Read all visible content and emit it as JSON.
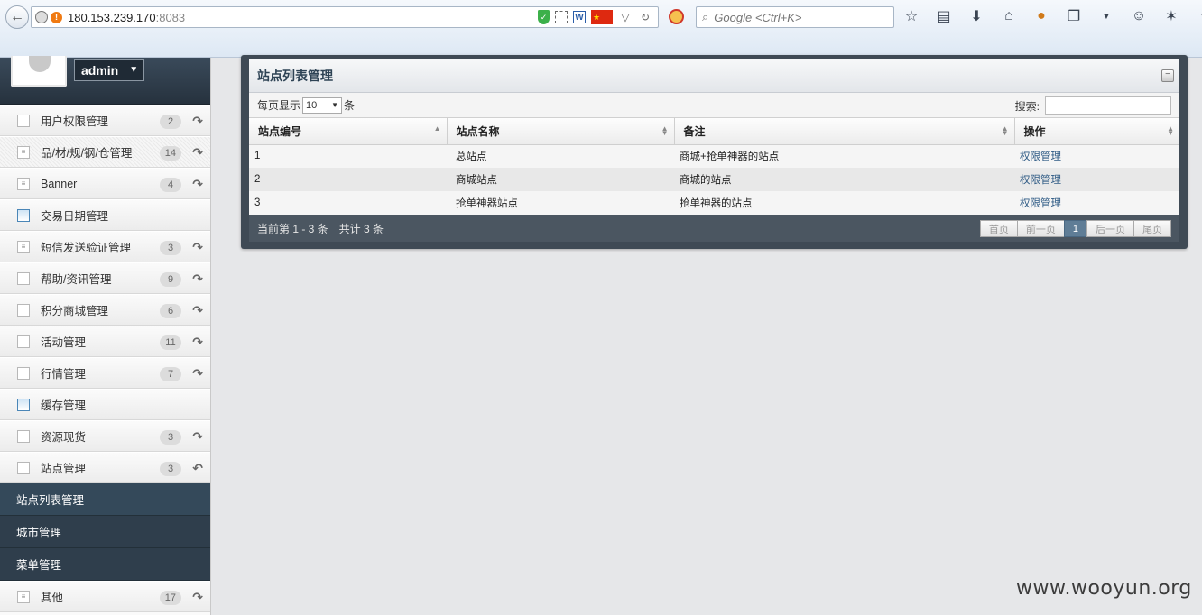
{
  "browser": {
    "url_host": "180.153.239.170",
    "url_port": ":8083",
    "search_placeholder": "Google <Ctrl+K>"
  },
  "user": {
    "name": "admin"
  },
  "sidebar": {
    "items": [
      {
        "label": "用户权限管理",
        "count": "2",
        "icon": "doc-icon"
      },
      {
        "label": "品/材/规/钢/仓管理",
        "count": "14",
        "icon": "list-icon"
      },
      {
        "label": "Banner",
        "count": "4",
        "icon": "list-icon"
      },
      {
        "label": "交易日期管理",
        "count": "",
        "icon": "window-icon"
      },
      {
        "label": "短信发送验证管理",
        "count": "3",
        "icon": "list-icon"
      },
      {
        "label": "帮助/资讯管理",
        "count": "9",
        "icon": "doc-icon"
      },
      {
        "label": "积分商城管理",
        "count": "6",
        "icon": "doc-icon"
      },
      {
        "label": "活动管理",
        "count": "11",
        "icon": "doc-icon"
      },
      {
        "label": "行情管理",
        "count": "7",
        "icon": "doc-icon"
      },
      {
        "label": "缓存管理",
        "count": "",
        "icon": "window-icon"
      },
      {
        "label": "资源现货",
        "count": "3",
        "icon": "doc-icon"
      },
      {
        "label": "站点管理",
        "count": "3",
        "icon": "doc-icon"
      }
    ],
    "sub_items": [
      {
        "label": "站点列表管理"
      },
      {
        "label": "城市管理"
      },
      {
        "label": "菜单管理"
      }
    ],
    "last_item": {
      "label": "其他",
      "count": "17"
    }
  },
  "panel": {
    "title": "站点列表管理",
    "per_page_label": "每页显示",
    "per_page_value": "10",
    "per_page_unit": "条",
    "search_label": "搜索:",
    "columns": [
      "站点编号",
      "站点名称",
      "备注",
      "操作"
    ],
    "rows": [
      {
        "id": "1",
        "name": "总站点",
        "note": "商城+抢单神器的站点",
        "action": "权限管理"
      },
      {
        "id": "2",
        "name": "商城站点",
        "note": "商城的站点",
        "action": "权限管理"
      },
      {
        "id": "3",
        "name": "抢单神器站点",
        "note": "抢单神器的站点",
        "action": "权限管理"
      }
    ],
    "footer_info": "当前第 1 - 3 条　共计 3 条",
    "pager": {
      "first": "首页",
      "prev": "前一页",
      "current": "1",
      "next": "后一页",
      "last": "尾页"
    }
  },
  "watermark": "www.wooyun.org"
}
